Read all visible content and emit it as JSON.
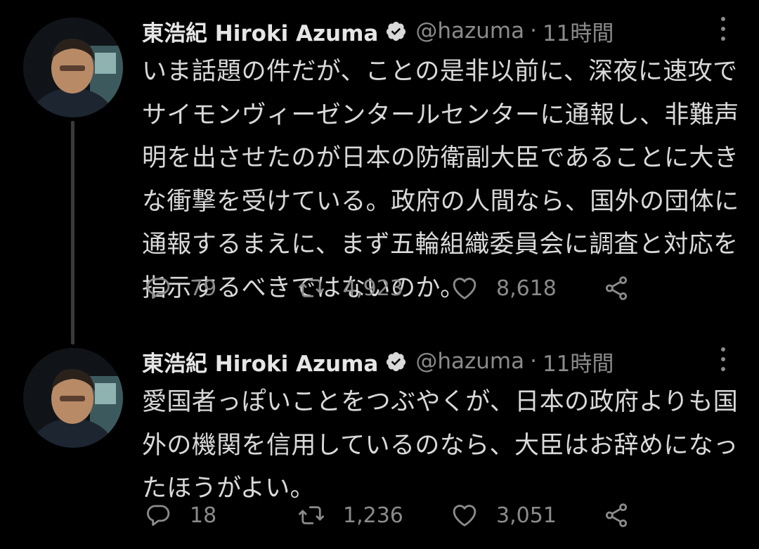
{
  "tweets": [
    {
      "author": {
        "display_name": "東浩紀 Hiroki Azuma",
        "handle": "@hazuma"
      },
      "separator": "·",
      "time": "11時間",
      "text": "いま話題の件だが、ことの是非以前に、深夜に速攻で\nサイモンヴィーゼンタールセンターに通報し、非難声\n明を出させたのが日本の防衛副大臣であることに大き\nな衝撃を受けている。政府の人間なら、国外の団体に\n通報するまえに、まず五輪組織委員会に調査と対応を\n指示するべきではないのか。",
      "stats": {
        "replies": "79",
        "retweets": "4,923",
        "likes": "8,618"
      }
    },
    {
      "author": {
        "display_name": "東浩紀 Hiroki Azuma",
        "handle": "@hazuma"
      },
      "separator": "·",
      "time": "11時間",
      "text": "愛国者っぽいことをつぶやくが、日本の政府よりも国\n外の機関を信用しているのなら、大臣はお辞めになっ\nたほうがよい。",
      "stats": {
        "replies": "18",
        "retweets": "1,236",
        "likes": "3,051"
      }
    }
  ],
  "icons": {
    "verified": "verified-badge-icon",
    "more": "more-vertical-icon",
    "reply": "reply-bubble-icon",
    "retweet": "retweet-icon",
    "like": "heart-icon",
    "share": "share-icon"
  },
  "colors": {
    "background": "#000000",
    "text": "#d9d9d9",
    "secondary": "#8b8b8b",
    "thread_line": "#3a3a3a"
  }
}
